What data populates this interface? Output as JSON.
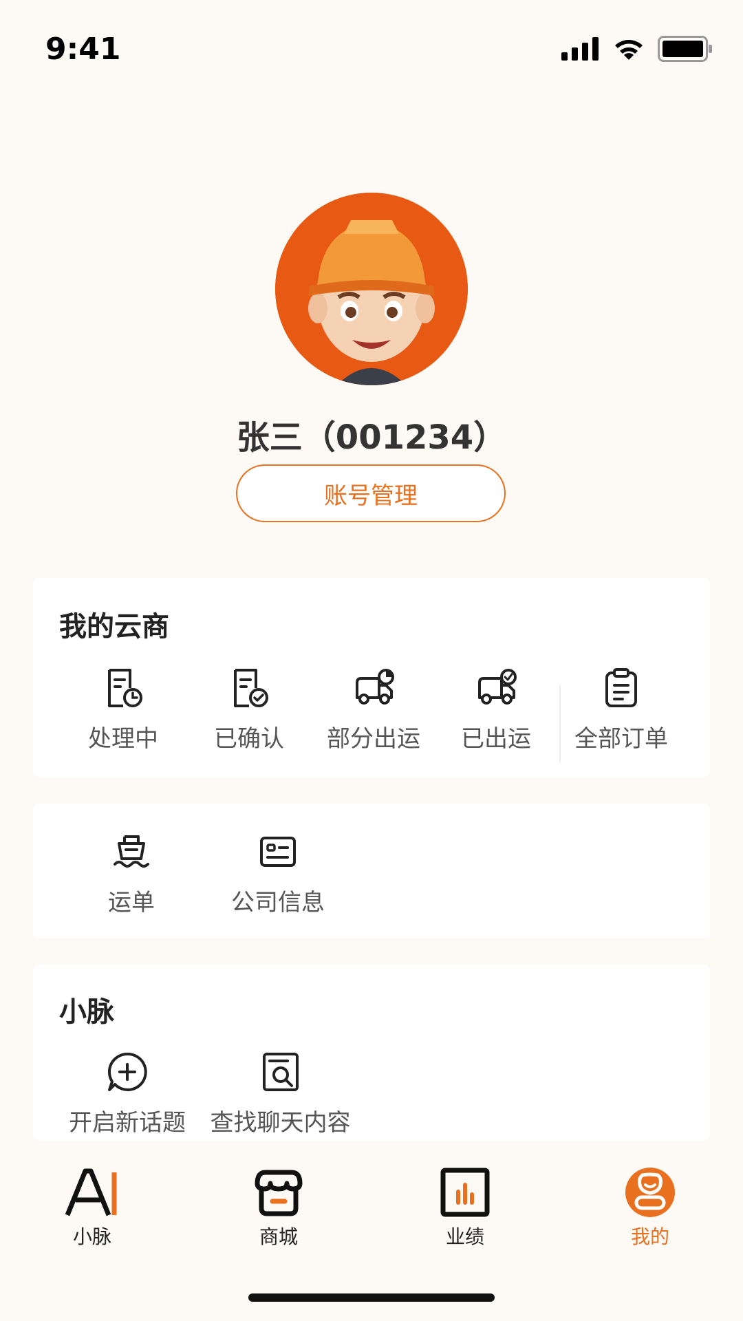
{
  "status": {
    "time": "9:41"
  },
  "profile": {
    "name": "张三（001234）",
    "account_button": "账号管理"
  },
  "my_cloud": {
    "title": "我的云商",
    "items": [
      {
        "label": "处理中",
        "icon": "doc-clock-icon"
      },
      {
        "label": "已确认",
        "icon": "doc-check-icon"
      },
      {
        "label": "部分出运",
        "icon": "truck-partial-icon"
      },
      {
        "label": "已出运",
        "icon": "truck-check-icon"
      },
      {
        "label": "全部订单",
        "icon": "clipboard-list-icon"
      }
    ]
  },
  "tools": {
    "items": [
      {
        "label": "运单",
        "icon": "ship-icon"
      },
      {
        "label": "公司信息",
        "icon": "id-card-icon"
      }
    ]
  },
  "xiaomai": {
    "title": "小脉",
    "items": [
      {
        "label": "开启新话题",
        "icon": "chat-plus-icon"
      },
      {
        "label": "查找聊天内容",
        "icon": "doc-search-icon"
      }
    ]
  },
  "tabbar": {
    "tabs": [
      {
        "label": "小脉",
        "icon": "ai-icon"
      },
      {
        "label": "商城",
        "icon": "store-icon"
      },
      {
        "label": "业绩",
        "icon": "chart-icon"
      },
      {
        "label": "我的",
        "icon": "profile-icon",
        "active": true
      }
    ]
  },
  "colors": {
    "accent": "#e8701f",
    "avatar_bg": "#e85a14",
    "background": "#fdf9f5"
  }
}
